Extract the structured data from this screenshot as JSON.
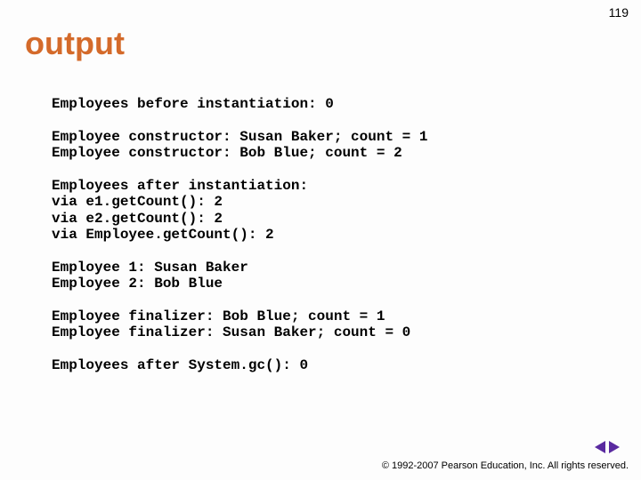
{
  "page_number": "119",
  "title": "output",
  "code": "Employees before instantiation: 0\n\nEmployee constructor: Susan Baker; count = 1\nEmployee constructor: Bob Blue; count = 2\n\nEmployees after instantiation:\nvia e1.getCount(): 2\nvia e2.getCount(): 2\nvia Employee.getCount(): 2\n\nEmployee 1: Susan Baker\nEmployee 2: Bob Blue\n\nEmployee finalizer: Bob Blue; count = 1\nEmployee finalizer: Susan Baker; count = 0\n\nEmployees after System.gc(): 0",
  "footer": "© 1992-2007 Pearson Education, Inc.  All rights reserved."
}
